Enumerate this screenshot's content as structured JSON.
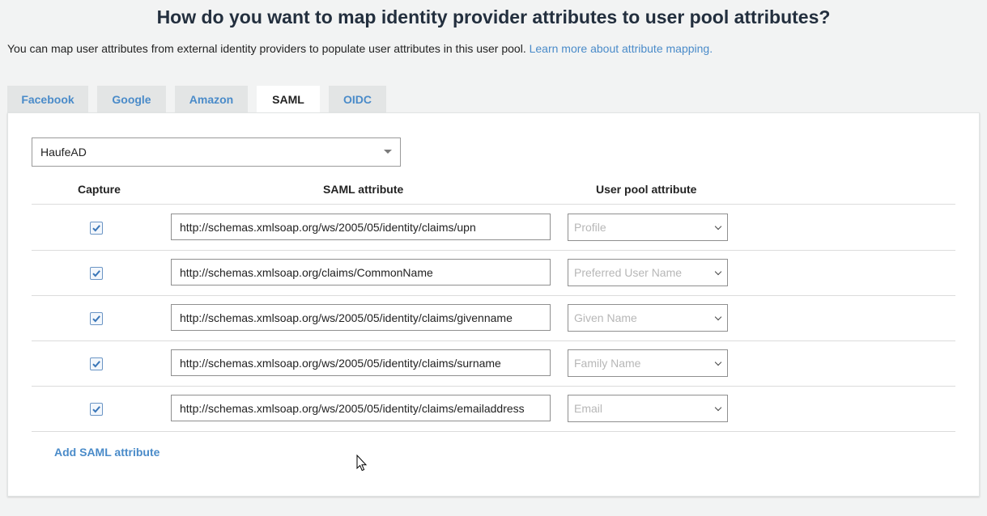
{
  "header": {
    "title": "How do you want to map identity provider attributes to user pool attributes?",
    "intro_text": "You can map user attributes from external identity providers to populate user attributes in this user pool. ",
    "learn_more_link": "Learn more about attribute mapping."
  },
  "tabs": [
    {
      "label": "Facebook",
      "active": false
    },
    {
      "label": "Google",
      "active": false
    },
    {
      "label": "Amazon",
      "active": false
    },
    {
      "label": "SAML",
      "active": true
    },
    {
      "label": "OIDC",
      "active": false
    }
  ],
  "provider": {
    "selected": "HaufeAD"
  },
  "table": {
    "headers": {
      "capture": "Capture",
      "saml_attribute": "SAML attribute",
      "user_pool_attribute": "User pool attribute"
    },
    "rows": [
      {
        "capture": true,
        "saml_attribute": "http://schemas.xmlsoap.org/ws/2005/05/identity/claims/upn",
        "user_pool_attribute": "Profile"
      },
      {
        "capture": true,
        "saml_attribute": "http://schemas.xmlsoap.org/claims/CommonName",
        "user_pool_attribute": "Preferred User Name"
      },
      {
        "capture": true,
        "saml_attribute": "http://schemas.xmlsoap.org/ws/2005/05/identity/claims/givenname",
        "user_pool_attribute": "Given Name"
      },
      {
        "capture": true,
        "saml_attribute": "http://schemas.xmlsoap.org/ws/2005/05/identity/claims/surname",
        "user_pool_attribute": "Family Name"
      },
      {
        "capture": true,
        "saml_attribute": "http://schemas.xmlsoap.org/ws/2005/05/identity/claims/emailaddress",
        "user_pool_attribute": "Email"
      }
    ]
  },
  "actions": {
    "add_label": "Add SAML attribute"
  },
  "icons": {
    "checkbox": "checkmark-icon",
    "dropdown": "chevron-down-icon",
    "cursor": "mouse-pointer-icon"
  },
  "colors": {
    "link": "#4a8bc9",
    "tab_inactive": "#e3e5e5",
    "background": "#f2f3f3",
    "panel": "#ffffff"
  }
}
